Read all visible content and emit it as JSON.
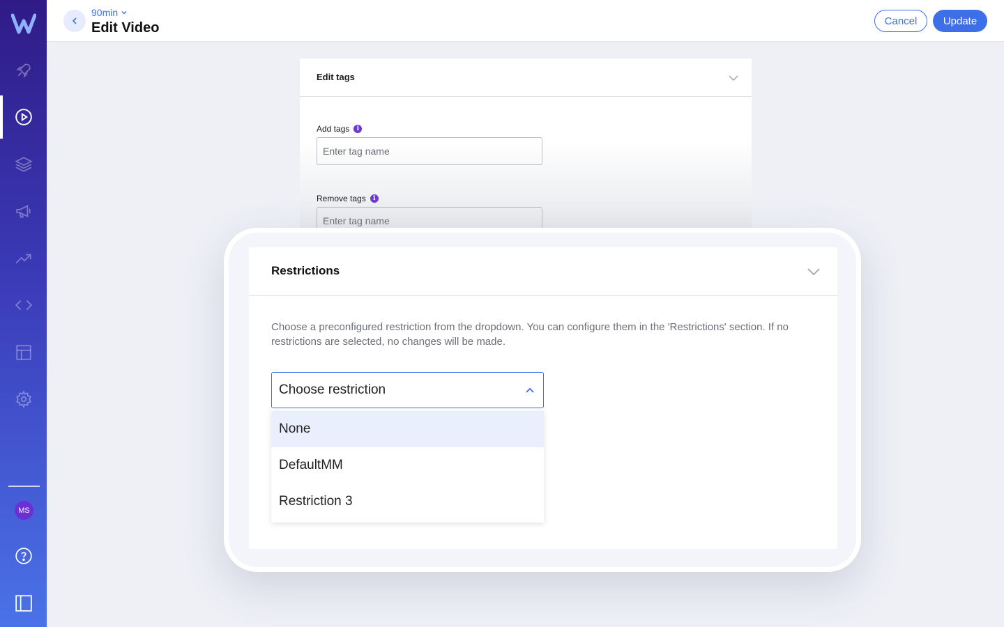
{
  "topbar": {
    "breadcrumb": "90min",
    "title": "Edit Video",
    "cancel_label": "Cancel",
    "update_label": "Update"
  },
  "sidebar": {
    "items": [
      "rocket-icon",
      "play-circle-icon",
      "layers-icon",
      "megaphone-icon",
      "trending-icon",
      "code-icon",
      "layout-icon",
      "gear-icon"
    ],
    "active": "play-circle-icon",
    "avatar_initials": "MS",
    "bottom": [
      "help-icon",
      "panel-toggle-icon"
    ]
  },
  "edit_tags": {
    "title": "Edit tags",
    "add_label": "Add tags",
    "add_placeholder": "Enter tag name",
    "remove_label": "Remove tags",
    "remove_placeholder": "Enter tag name"
  },
  "restrictions": {
    "title": "Restrictions",
    "description": "Choose a preconfigured restriction from the dropdown. You can configure them in the 'Restrictions' section. If no restrictions are selected, no changes will be made.",
    "select_placeholder": "Choose restriction",
    "options": [
      "None",
      "DefaultMM",
      "Restriction 3"
    ],
    "highlighted_option": "None"
  },
  "colors": {
    "accent": "#3d6fe8",
    "sidebar_top": "#2f1b86",
    "sidebar_bottom": "#4a72e8",
    "info": "#6e37d8"
  }
}
